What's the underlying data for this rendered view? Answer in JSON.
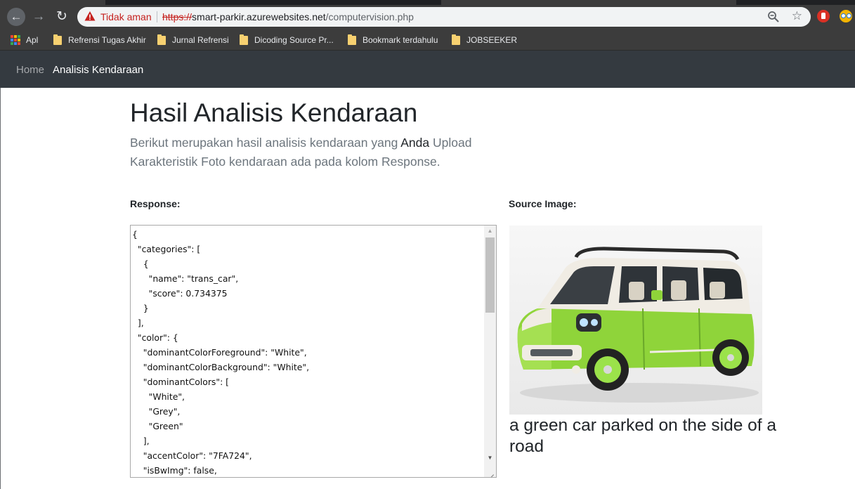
{
  "browser": {
    "security_label": "Tidak aman",
    "url_scheme": "https://",
    "url_host": "smart-parkir.azurewebsites.net",
    "url_path": "/computervision.php"
  },
  "bookmarks": {
    "apps_label": "Apl",
    "items": [
      "Refrensi Tugas Akhir",
      "Jurnal Refrensi",
      "Dicoding Source Pr...",
      "Bookmark terdahulu",
      "JOBSEEKER"
    ]
  },
  "navbar": {
    "home": "Home",
    "active": "Analisis Kendaraan"
  },
  "page": {
    "title": "Hasil Analisis Kendaraan",
    "lead_line1_pre": "Berikut merupakan hasil analisis kendaraan yang ",
    "lead_line1_em": "Anda",
    "lead_line1_post": " Upload",
    "lead_line2": "Karakteristik Foto kendaraan ada pada kolom Response.",
    "response_label": "Response:",
    "source_label": "Source Image:",
    "response_json": "{\n  \"categories\": [\n    {\n      \"name\": \"trans_car\",\n      \"score\": 0.734375\n    }\n  ],\n  \"color\": {\n    \"dominantColorForeground\": \"White\",\n    \"dominantColorBackground\": \"White\",\n    \"dominantColors\": [\n      \"White\",\n      \"Grey\",\n      \"Green\"\n    ],\n    \"accentColor\": \"7FA724\",\n    \"isBwImg\": false,",
    "caption": "a green car parked on the side of a road"
  },
  "colors": {
    "navbar_bg": "#343a40",
    "browser_bg": "#3c3c3c",
    "car_green": "#8fd43a",
    "accent": "#7FA724"
  },
  "icons": [
    "back-arrow-icon",
    "forward-arrow-icon",
    "reload-icon",
    "warning-icon",
    "zoom-icon",
    "star-icon",
    "apps-grid-icon",
    "folder-icon"
  ]
}
